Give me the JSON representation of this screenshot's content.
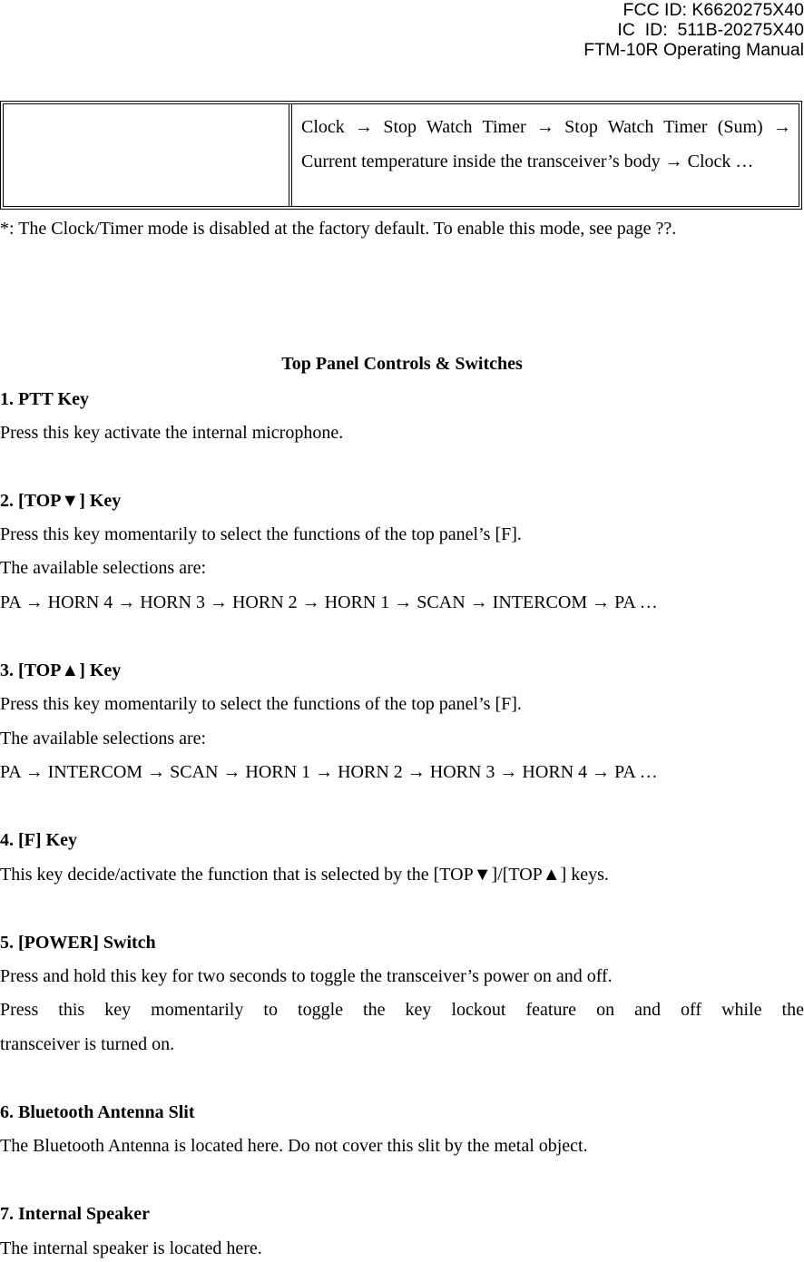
{
  "header": {
    "fcc_id": "FCC ID: K6620275X40",
    "ic_id": "IC  ID:  511B-20275X40",
    "manual_title": "FTM-10R Operating Manual"
  },
  "table": {
    "left_cell": "",
    "right_cell": "Clock → Stop Watch Timer → Stop Watch Timer (Sum) → Current temperature inside the transceiver’s body → Clock …"
  },
  "note": "*: The Clock/Timer mode is disabled at the factory default. To enable this mode, see page ??.",
  "section_title": "Top Panel Controls & Switches",
  "items": [
    {
      "heading": "1. PTT Key",
      "lines": [
        "Press this key activate the internal microphone."
      ]
    },
    {
      "heading": "2. [TOP▼] Key",
      "lines": [
        "Press this key momentarily to select the functions of the top panel’s [F].",
        "The available selections are:",
        "PA → HORN 4 → HORN 3 → HORN 2 → HORN 1 → SCAN → INTERCOM → PA …"
      ]
    },
    {
      "heading": "3. [TOP▲] Key",
      "lines": [
        "Press this key momentarily to select the functions of the top panel’s [F].",
        "The available selections are:",
        "PA → INTERCOM → SCAN → HORN 1 → HORN 2 → HORN 3 → HORN 4 → PA …"
      ]
    },
    {
      "heading": "4. [F] Key",
      "lines": [
        "This key decide/activate the function that is selected by the [TOP▼]/[TOP▲] keys."
      ]
    },
    {
      "heading": "5. [POWER] Switch",
      "lines": [
        "Press and hold this key for two seconds to toggle the transceiver’s power on and off.",
        "Press this key momentarily to toggle the key lockout feature on and off while the",
        "transceiver is turned on."
      ]
    },
    {
      "heading": "6. Bluetooth Antenna Slit",
      "lines": [
        "The Bluetooth Antenna is located here. Do not cover this slit by the metal object."
      ]
    },
    {
      "heading": "7. Internal Speaker",
      "lines": [
        "The internal speaker is located here."
      ]
    }
  ]
}
